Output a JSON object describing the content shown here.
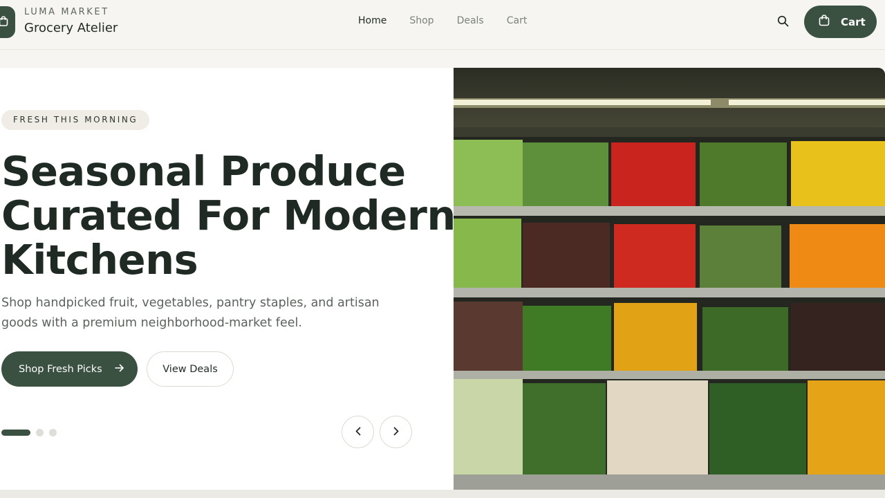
{
  "brand": {
    "eyebrow": "LUMA MARKET",
    "name": "Grocery Atelier",
    "logo_icon": "shopping-bag-icon"
  },
  "nav": {
    "items": [
      {
        "label": "Home",
        "active": true
      },
      {
        "label": "Shop",
        "active": false
      },
      {
        "label": "Deals",
        "active": false
      },
      {
        "label": "Cart",
        "active": false
      }
    ],
    "search_icon": "search-icon",
    "cart_button": {
      "label": "Cart",
      "icon": "shopping-bag-icon"
    }
  },
  "hero": {
    "eyebrow": "FRESH THIS MORNING",
    "headline_lines": [
      "Seasonal Produce",
      "Curated For Modern",
      "Kitchens"
    ],
    "subcopy": "Shop handpicked fruit, vegetables, pantry staples, and artisan goods with a premium neighborhood-market feel.",
    "primary_cta": {
      "label": "Shop Fresh Picks",
      "icon": "arrow-right-icon"
    },
    "secondary_cta": {
      "label": "View Deals"
    },
    "carousel": {
      "slide_count": 3,
      "active_index": 0,
      "prev_icon": "chevron-left-icon",
      "next_icon": "chevron-right-icon"
    },
    "image": {
      "subject": "produce-shelves-photo"
    }
  },
  "colors": {
    "brand_green": "#3a5141",
    "page_bg": "#f6f5f1",
    "text_dark": "#1f2a24",
    "text_muted": "#5b625d"
  }
}
